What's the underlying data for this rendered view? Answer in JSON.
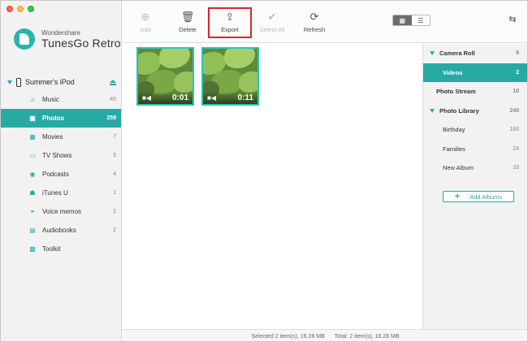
{
  "app": {
    "brand_top": "Wondershare",
    "brand_name": "TunesGo Retro",
    "accent_color": "#27aaa3",
    "highlight_color": "#d9262b"
  },
  "device": {
    "name": "Summer's iPod",
    "icon": "ipod-icon",
    "eject_icon": "eject-icon"
  },
  "sidebar": {
    "items": [
      {
        "label": "Music",
        "count": "45",
        "icon": "music-icon"
      },
      {
        "label": "Photos",
        "count": "259",
        "icon": "photos-icon",
        "active": true
      },
      {
        "label": "Movies",
        "count": "7",
        "icon": "movies-icon"
      },
      {
        "label": "TV Shows",
        "count": "5",
        "icon": "tv-icon"
      },
      {
        "label": "Podcasts",
        "count": "4",
        "icon": "podcast-icon"
      },
      {
        "label": "iTunes U",
        "count": "1",
        "icon": "itunes-u-icon"
      },
      {
        "label": "Voice memos",
        "count": "2",
        "icon": "voicemail-icon"
      },
      {
        "label": "Audiobooks",
        "count": "2",
        "icon": "audiobook-icon"
      },
      {
        "label": "Toolkit",
        "count": "",
        "icon": "toolkit-icon"
      }
    ]
  },
  "toolbar": {
    "add_label": "Add",
    "delete_label": "Delete",
    "export_label": "Export",
    "select_all_label": "Select All",
    "refresh_label": "Refresh"
  },
  "media": {
    "items": [
      {
        "duration": "0:01",
        "type_icon": "video-camera-icon"
      },
      {
        "duration": "0:11",
        "type_icon": "video-camera-icon"
      }
    ]
  },
  "albums": {
    "items": [
      {
        "label": "Camera Roll",
        "count": "9",
        "kind": "group"
      },
      {
        "label": "Videos",
        "count": "2",
        "kind": "sub",
        "active": true
      },
      {
        "label": "Photo Stream",
        "count": "10",
        "kind": "plain"
      },
      {
        "label": "Photo Library",
        "count": "240",
        "kind": "group"
      },
      {
        "label": "Birthday",
        "count": "183",
        "kind": "sub"
      },
      {
        "label": "Families",
        "count": "24",
        "kind": "sub"
      },
      {
        "label": "New Album",
        "count": "33",
        "kind": "sub"
      }
    ],
    "add_label": "Add Albums"
  },
  "status": {
    "selected": "Selected 2 item(s), 16.28 MB",
    "total": "Total: 2 item(s), 16.28 MB"
  }
}
